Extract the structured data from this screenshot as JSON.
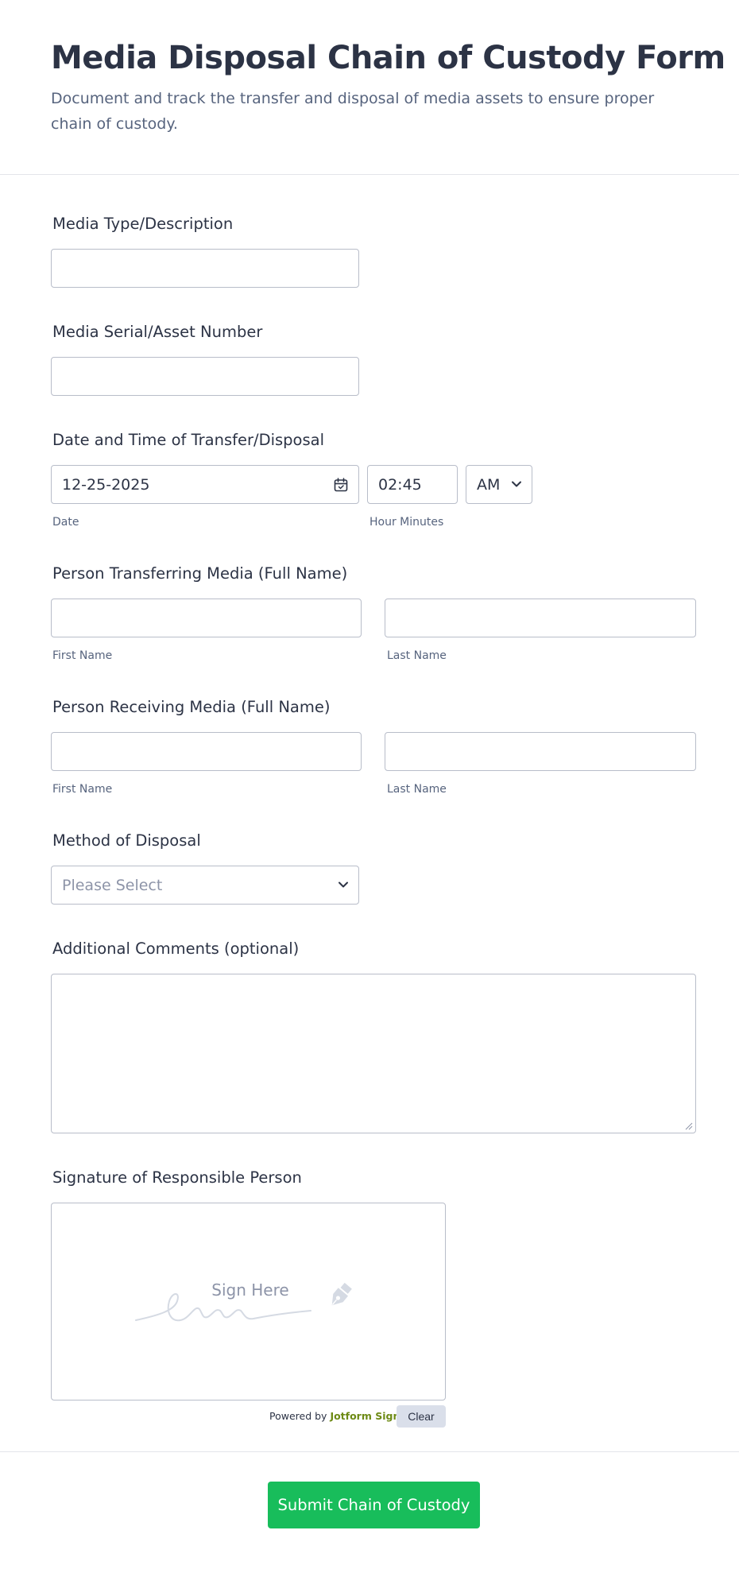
{
  "form": {
    "title": "Media Disposal Chain of Custody Form",
    "subtitle": "Document and track the transfer and disposal of media assets to ensure proper chain of custody."
  },
  "fields": {
    "media_type": {
      "label": "Media Type/Description",
      "value": ""
    },
    "serial": {
      "label": "Media Serial/Asset Number",
      "value": ""
    },
    "datetime": {
      "label": "Date and Time of Transfer/Disposal",
      "date_value": "12-25-2025",
      "time_value": "02:45",
      "ampm_value": "AM",
      "date_sublabel": "Date",
      "time_sublabel": "Hour Minutes"
    },
    "transferring": {
      "label": "Person Transferring Media (Full Name)",
      "first_sublabel": "First Name",
      "last_sublabel": "Last Name"
    },
    "receiving": {
      "label": "Person Receiving Media (Full Name)",
      "first_sublabel": "First Name",
      "last_sublabel": "Last Name"
    },
    "method": {
      "label": "Method of Disposal",
      "placeholder": "Please Select"
    },
    "comments": {
      "label": "Additional Comments (optional)",
      "value": ""
    },
    "signature": {
      "label": "Signature of Responsible Person",
      "placeholder": "Sign Here",
      "powered_prefix": "Powered by",
      "powered_brand": "Jotform Sign",
      "clear_label": "Clear"
    }
  },
  "submit_label": "Submit Chain of Custody",
  "colors": {
    "submit": "#18bd5b",
    "brand": "#6d8a14",
    "border": "#b8bdc9"
  },
  "icons": [
    "calendar-icon",
    "chevron-down-icon",
    "signature-pen-icon",
    "resize-grip-icon"
  ]
}
